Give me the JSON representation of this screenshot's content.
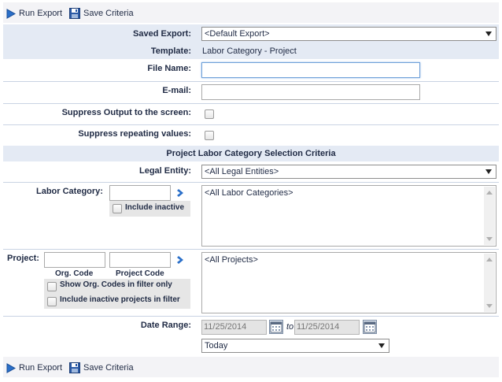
{
  "toolbar": {
    "run_export": "Run Export",
    "save_criteria": "Save Criteria"
  },
  "form": {
    "saved_export_label": "Saved Export:",
    "saved_export_value": "<Default Export>",
    "template_label": "Template:",
    "template_value": "Labor Category - Project",
    "file_name_label": "File Name:",
    "file_name_value": "",
    "email_label": "E-mail:",
    "email_value": "",
    "suppress_output_label": "Suppress Output to the screen:",
    "suppress_repeating_label": "Suppress repeating values:"
  },
  "criteria": {
    "section_title": "Project Labor Category Selection Criteria",
    "legal_entity_label": "Legal Entity:",
    "legal_entity_value": "<All Legal Entities>",
    "labor_category_label": "Labor Category:",
    "labor_category_filter": "",
    "include_inactive_label": "Include inactive",
    "labor_category_list": [
      "<All Labor Categories>"
    ],
    "project_label": "Project:",
    "org_code_label": "Org. Code",
    "project_code_label": "Project Code",
    "show_org_codes_label": "Show Org. Codes in filter only",
    "include_inactive_projects_label": "Include inactive projects in filter",
    "project_list": [
      "<All Projects>"
    ],
    "date_range_label": "Date Range:",
    "date_from": "11/25/2014",
    "date_to_label": "to",
    "date_to": "11/25/2014",
    "date_preset": "Today"
  },
  "colors": {
    "header_band": "#e4eaf4",
    "toolbar_bg": "#f3f3f6",
    "accent_blue": "#2a6fc9"
  }
}
